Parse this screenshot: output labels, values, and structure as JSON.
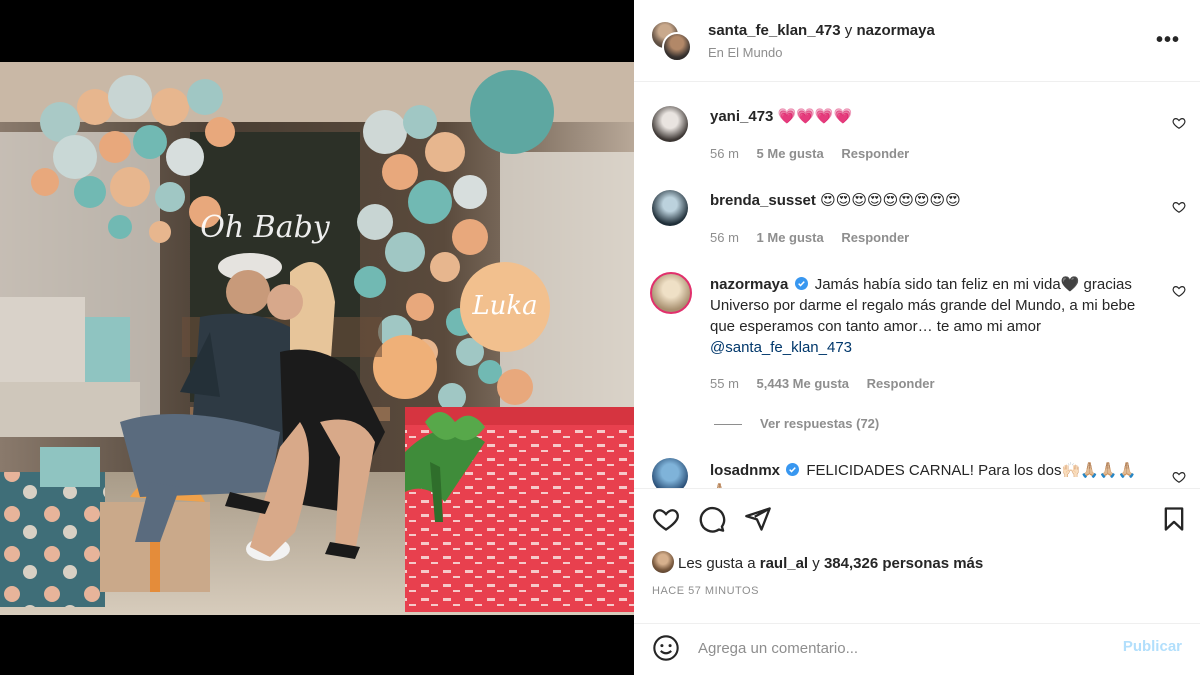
{
  "post": {
    "author": "santa_fe_klan_473",
    "joiner": "y",
    "coauthor": "nazormaya",
    "location": "En El Mundo",
    "more_label": "•••"
  },
  "photo": {
    "neon_sign": "Oh Baby",
    "balloon_name": "Luka"
  },
  "comments": [
    {
      "user": "yani_473",
      "text": "💗💗💗💗",
      "time": "56 m",
      "likes": "5 Me gusta",
      "reply": "Responder"
    },
    {
      "user": "brenda_susset",
      "text": "😍😍😍😍😍😍😍😍😍",
      "time": "56 m",
      "likes": "1 Me gusta",
      "reply": "Responder"
    },
    {
      "user": "nazormaya",
      "text": "Jamás había sido tan feliz en mi vida🖤 gracias Universo por darme el regalo más grande del Mundo, a mi bebe que esperamos con tanto amor… te amo mi amor ",
      "mention": "@santa_fe_klan_473",
      "time": "55 m",
      "likes": "5,443 Me gusta",
      "reply": "Responder",
      "view_replies": "Ver respuestas (72)"
    },
    {
      "user": "losadnmx",
      "text": "FELICIDADES CARNAL! Para los dos🙌🏻🙏🏼🙏🏼🙏🏼🙏🏼"
    }
  ],
  "likes_line": {
    "prefix": "Les gusta a",
    "user": "raul_al",
    "joiner": "y",
    "count": "384,326 personas más"
  },
  "timestamp": "HACE 57 MINUTOS",
  "composer": {
    "placeholder": "Agrega un comentario...",
    "publish": "Publicar"
  },
  "colors": {
    "verified": "#3897f0",
    "mention": "#00376b",
    "publish_disabled": "#b2dffc",
    "secondary_text": "#8e8e8e"
  }
}
